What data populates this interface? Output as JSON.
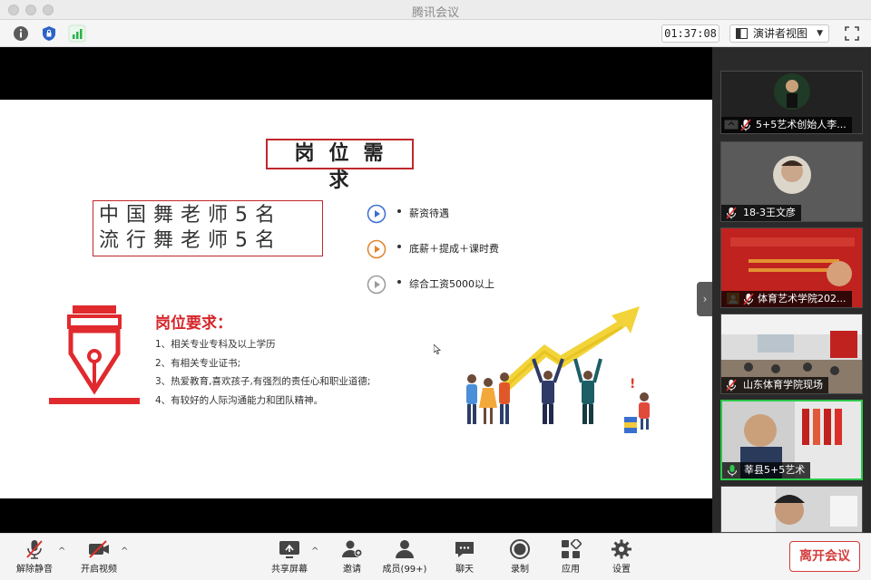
{
  "window": {
    "title": "腾讯会议"
  },
  "toolbar": {
    "timer": "01:37:08",
    "view_mode": "演讲者视图"
  },
  "slide": {
    "title": "岗位需求",
    "teachers": [
      "中国舞老师5名",
      "流行舞老师5名"
    ],
    "benefits": [
      {
        "text": "薪资待遇",
        "color": "#3a6fd0"
      },
      {
        "text": "底薪＋提成＋课时费",
        "color": "#e0832d"
      },
      {
        "text": "综合工资5000以上",
        "color": "#9a9a9a"
      }
    ],
    "requirements_title": "岗位要求：",
    "requirements": [
      "1、相关专业专科及以上学历",
      "2、有相关专业证书;",
      "3、热爱教育,喜欢孩子,有强烈的责任心和职业道德;",
      "4、有较好的人际沟通能力和团队精神。"
    ]
  },
  "participants": [
    {
      "name": "5+5艺术创始人李...",
      "thumb": "avatar-dark"
    },
    {
      "name": "18-3王文彦",
      "thumb": "avatar-light"
    },
    {
      "name": "体育艺术学院202...",
      "thumb": "banner-red"
    },
    {
      "name": "山东体育学院现场",
      "thumb": "classroom"
    },
    {
      "name": "莘县5+5艺术",
      "thumb": "person-office",
      "active": true
    },
    {
      "name": "",
      "thumb": "person-partial"
    }
  ],
  "bottom": {
    "mute": "解除静音",
    "video": "开启视频",
    "share": "共享屏幕",
    "invite": "邀请",
    "members": "成员(99+)",
    "chat": "聊天",
    "record": "录制",
    "apps": "应用",
    "settings": "设置",
    "leave": "离开会议"
  },
  "colors": {
    "accent_red": "#d6262b",
    "active_green": "#2bc84b"
  }
}
